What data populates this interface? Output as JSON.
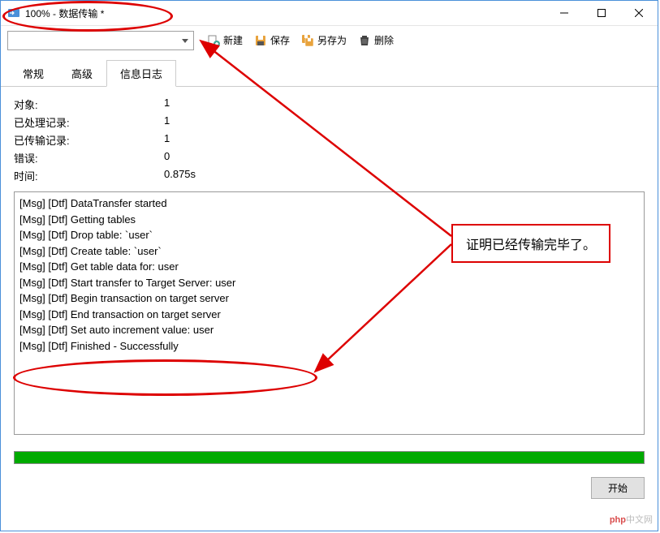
{
  "window": {
    "title": "100% - 数据传输 *"
  },
  "toolbar": {
    "new_label": "新建",
    "save_label": "保存",
    "saveas_label": "另存为",
    "delete_label": "删除"
  },
  "tabs": {
    "general": "常规",
    "advanced": "高级",
    "log": "信息日志"
  },
  "stats": {
    "objects_label": "对象:",
    "objects_value": "1",
    "processed_label": "已处理记录:",
    "processed_value": "1",
    "transferred_label": "已传输记录:",
    "transferred_value": "1",
    "errors_label": "错误:",
    "errors_value": "0",
    "time_label": "时间:",
    "time_value": "0.875s"
  },
  "log_lines": [
    "[Msg] [Dtf] DataTransfer started",
    "[Msg] [Dtf] Getting tables",
    "[Msg] [Dtf] Drop table: `user`",
    "[Msg] [Dtf] Create table: `user`",
    "[Msg] [Dtf] Get table data for: user",
    "[Msg] [Dtf] Start transfer to Target Server: user",
    "[Msg] [Dtf] Begin transaction on target server",
    "[Msg] [Dtf] End transaction on target server",
    "[Msg] [Dtf] Set auto increment value: user",
    "[Msg] [Dtf] Finished - Successfully"
  ],
  "footer": {
    "start_label": "开始"
  },
  "annotation": {
    "note": "证明已经传输完毕了。"
  },
  "watermark": {
    "prefix": "php",
    "suffix": "中文网"
  }
}
